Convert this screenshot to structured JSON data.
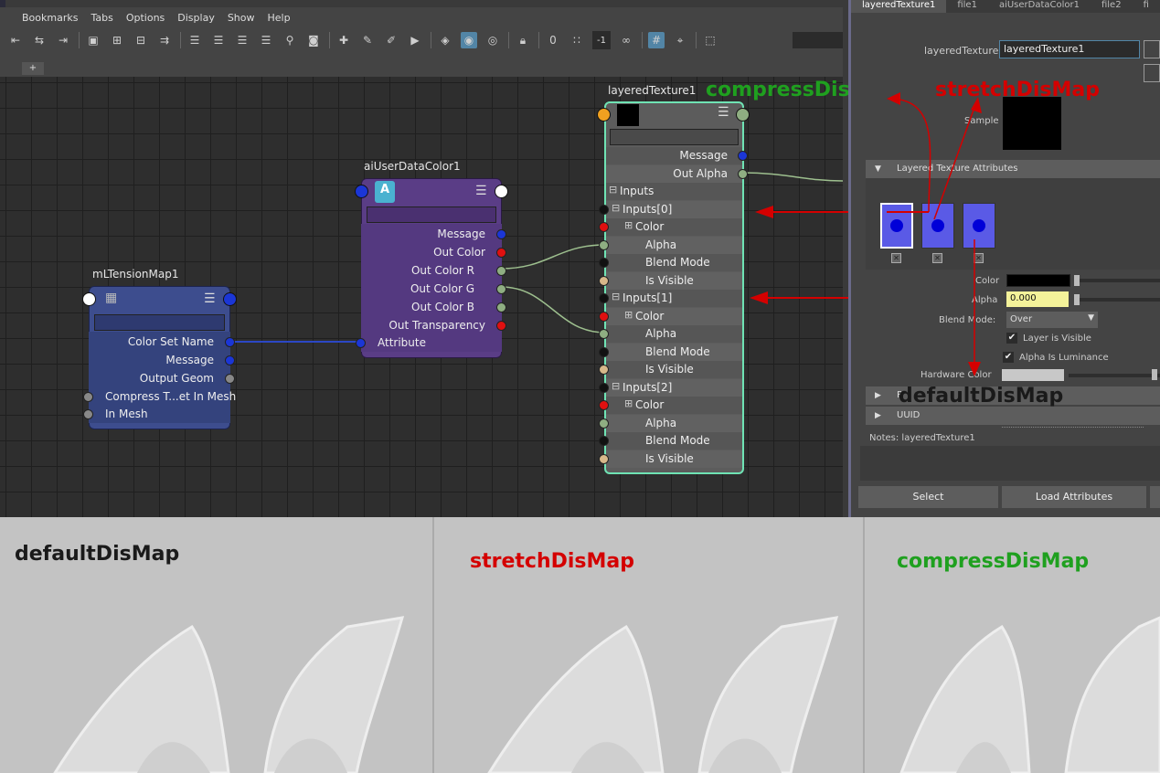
{
  "menu": [
    "Bookmarks",
    "Tabs",
    "Options",
    "Display",
    "Show",
    "Help"
  ],
  "toolbar": {
    "num_field": "-1",
    "add_tab": "+"
  },
  "nodes": {
    "tension": {
      "title": "mLTensionMap1",
      "rows": [
        "Color Set Name",
        "Message",
        "Output Geom",
        "Compress T...et In Mesh",
        "In Mesh"
      ]
    },
    "userdata": {
      "title": "aiUserDataColor1",
      "icon_letter": "A",
      "rows": [
        "Message",
        "Out Color",
        "Out Color R",
        "Out Color G",
        "Out Color B",
        "Out Transparency",
        "Attribute"
      ]
    },
    "layered": {
      "title": "layeredTexture1",
      "rows": [
        "Message",
        "Out Alpha",
        "Inputs",
        "Inputs[0]",
        "Color",
        "Alpha",
        "Blend Mode",
        "Is Visible",
        "Inputs[1]",
        "Color",
        "Alpha",
        "Blend Mode",
        "Is Visible",
        "Inputs[2]",
        "Color",
        "Alpha",
        "Blend Mode",
        "Is Visible"
      ]
    }
  },
  "attr_editor": {
    "tabs": [
      "layeredTexture1",
      "file1",
      "aiUserDataColor1",
      "file2",
      "fi"
    ],
    "name_label": "layeredTexture:",
    "name_value": "layeredTexture1",
    "sample_label": "Sample",
    "section_layered": "Layered Texture Attributes",
    "color_label": "Color",
    "alpha_label": "Alpha",
    "alpha_value": "0.000",
    "blend_label": "Blend Mode:",
    "blend_value": "Over",
    "layer_visible": "Layer is Visible",
    "alpha_lum": "Alpha Is Luminance",
    "hw_color": "Hardware Color",
    "section_collapsed": "R",
    "section_uuid": "UUID",
    "notes": "Notes:  layeredTexture1",
    "select_btn": "Select",
    "load_btn": "Load Attributes"
  },
  "overlays": {
    "compress": "compressDisMap",
    "stretch": "stretchDisMap",
    "default": "defaultDisMap"
  },
  "panels": {
    "default": "defaultDisMap",
    "stretch": "stretchDisMap",
    "compress": "compressDisMap"
  },
  "colors": {
    "red": "#d40000",
    "green": "#1fa01f",
    "dark": "#1a1a1a",
    "node_purple": "#5a3d86",
    "node_blue": "#2d3f8a",
    "node_gray": "#5c5c5c"
  }
}
